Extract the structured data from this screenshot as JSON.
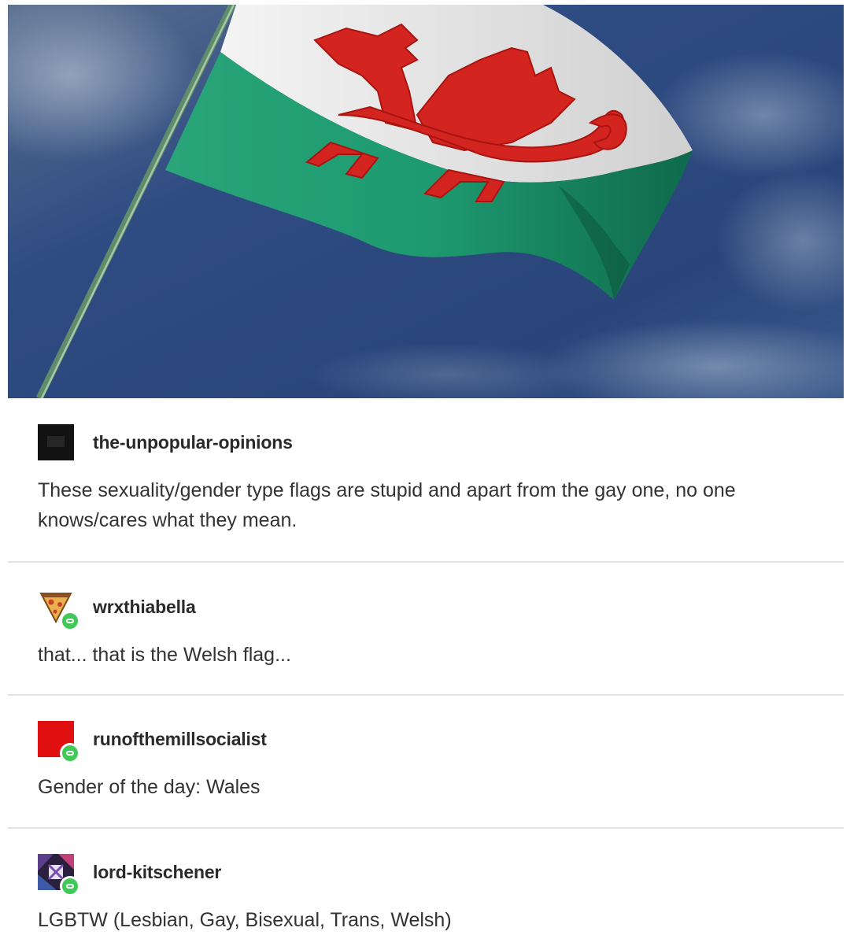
{
  "hero": {
    "image": "welsh-flag-waving-against-blue-sky"
  },
  "posts": [
    {
      "username": "the-unpopular-opinions",
      "avatar": "dark-square-avatar",
      "body": "These sexuality/gender type flags are stupid and apart from the gay one, no one knows/cares what they mean."
    },
    {
      "username": "wrxthiabella",
      "avatar": "pizza-slice-avatar",
      "body": "that... that is the Welsh flag..."
    },
    {
      "username": "runofthemillsocialist",
      "avatar": "red-square-avatar",
      "body": "Gender of the day: Wales"
    },
    {
      "username": "lord-kitschener",
      "avatar": "purple-pattern-avatar",
      "body": "LGBTW (Lesbian, Gay, Bisexual, Trans, Welsh)"
    }
  ],
  "colors": {
    "follow_badge": "#40c957",
    "divider": "#e4e4e4",
    "flag_green": "#1f9e73",
    "flag_red": "#d42420"
  }
}
